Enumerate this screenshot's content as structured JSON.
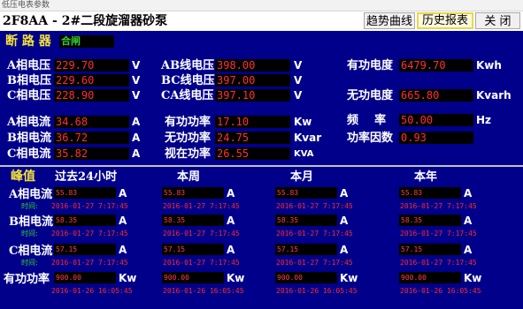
{
  "window": {
    "title": "低压电表参数"
  },
  "header": {
    "title": "2F8AA - 2#二段旋溜器砂泵",
    "buttons": {
      "trend": "趋势曲线",
      "history": "历史报表",
      "close": "关 闭"
    }
  },
  "breaker": {
    "label": "断 路 器",
    "status": "合闸"
  },
  "readings": [
    {
      "label": "A相电压",
      "value": "229.70",
      "unit": "V"
    },
    {
      "label": "B相电压",
      "value": "229.60",
      "unit": "V"
    },
    {
      "label": "C相电压",
      "value": "228.90",
      "unit": "V"
    },
    {
      "label": "AB线电压",
      "value": "398.00",
      "unit": "V"
    },
    {
      "label": "BC线电压",
      "value": "397.00",
      "unit": "V"
    },
    {
      "label": "CA线电压",
      "value": "397.10",
      "unit": "V"
    },
    {
      "label": "有功电度",
      "value": "6479.70",
      "unit": "Kwh"
    },
    {
      "label": "无功电度",
      "value": "665.80",
      "unit": "Kvarh"
    },
    {
      "label": "A相电流",
      "value": "34.68",
      "unit": "A"
    },
    {
      "label": "B相电流",
      "value": "36.72",
      "unit": "A"
    },
    {
      "label": "C相电流",
      "value": "35.82",
      "unit": "A"
    },
    {
      "label": "有功功率",
      "value": "17.10",
      "unit": "Kw"
    },
    {
      "label": "无功功率",
      "value": "24.75",
      "unit": "Kvar"
    },
    {
      "label": "视在功率",
      "value": "26.55",
      "unit": "KVA"
    },
    {
      "label": "频    率",
      "value": "50.00",
      "unit": "Hz"
    },
    {
      "label": "功率因数",
      "value": "0.93",
      "unit": ""
    }
  ],
  "peak": {
    "title": "峰值",
    "periods": [
      "过去24小时",
      "本周",
      "本月",
      "本年"
    ],
    "time_label": "时间:",
    "rows": [
      {
        "label": "A相电流",
        "unit": "A",
        "cells": [
          {
            "value": "55.83",
            "time": "2016-01-27 7:17:45"
          },
          {
            "value": "55.83",
            "time": "2016-01-27 7:17:45"
          },
          {
            "value": "55.83",
            "time": "2016-01-27 7:17:45"
          },
          {
            "value": "55.83",
            "time": "2016-01-27 7:17:45"
          }
        ]
      },
      {
        "label": "B相电流",
        "unit": "A",
        "cells": [
          {
            "value": "58.35",
            "time": "2016-01-27 7:17:45"
          },
          {
            "value": "58.35",
            "time": "2016-01-27 7:17:45"
          },
          {
            "value": "58.35",
            "time": "2016-01-27 7:17:45"
          },
          {
            "value": "58.35",
            "time": "2016-01-27 7:17:45"
          }
        ]
      },
      {
        "label": "C相电流",
        "unit": "A",
        "cells": [
          {
            "value": "57.15",
            "time": "2016-01-27 7:17:45"
          },
          {
            "value": "57.15",
            "time": "2016-01-27 7:17:45"
          },
          {
            "value": "57.15",
            "time": "2016-01-27 7:17:45"
          },
          {
            "value": "57.15",
            "time": "2016-01-27 7:17:45"
          }
        ]
      },
      {
        "label": "有功功率",
        "unit": "Kw",
        "cells": [
          {
            "value": "900.00",
            "time": "2016-01-26 16:05:45"
          },
          {
            "value": "900.00",
            "time": "2016-01-26 16:05:45"
          },
          {
            "value": "900.00",
            "time": "2016-01-26 16:05:45"
          },
          {
            "value": "900.00",
            "time": "2016-01-26 16:05:45"
          }
        ]
      }
    ]
  },
  "colors": {
    "panel": "#00008a",
    "label": "#ffffff",
    "heading": "#f5e23a",
    "value": "#ff3030",
    "status": "#35d435",
    "value_bg": "#000000"
  }
}
